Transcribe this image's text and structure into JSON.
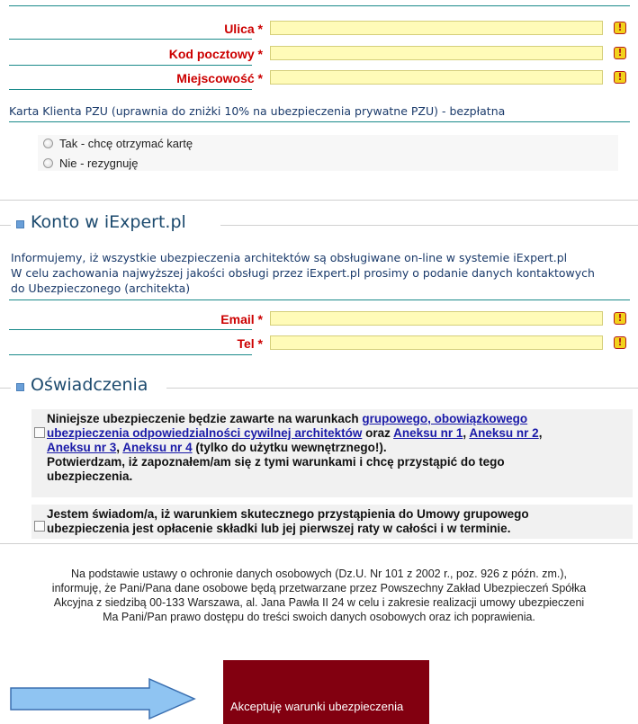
{
  "address": {
    "fields": [
      {
        "label": "Ulica",
        "required": "*",
        "warning": "!"
      },
      {
        "label": "Kod pocztowy",
        "required": "*",
        "warning": "!"
      },
      {
        "label": "Miejscowość",
        "required": "*",
        "warning": "!"
      }
    ]
  },
  "card": {
    "title": "Karta Klienta PZU (uprawnia do zniżki 10% na ubezpieczenia prywatne PZU) - bezpłatna",
    "options": [
      "Tak - chcę otrzymać kartę",
      "Nie - rezygnuję"
    ]
  },
  "account": {
    "title": "Konto w iExpert.pl",
    "info_lines": [
      "Informujemy, iż wszystkie ubezpieczenia architektów są obsługiwane on-line w systemie iExpert.pl",
      "W celu zachowania najwyższej jakości obsługi przez iExpert.pl prosimy o podanie danych kontaktowych",
      "do Ubezpieczonego (architekta)"
    ],
    "fields": [
      {
        "label": "Email",
        "required": "*",
        "warning": "!"
      },
      {
        "label": "Tel",
        "required": "*",
        "warning": "!"
      }
    ]
  },
  "declarations": {
    "title": "Oświadczenia",
    "first": {
      "t1": "Niniejsze ubezpieczenie będzie zawarte na warunkach ",
      "link1a": "grupowego, obowiązkowego",
      "link1b": "ubezpieczenia odpowiedzialności cywilnej architektów",
      "t2": " oraz ",
      "link2": "Aneksu nr 1",
      "t3": ", ",
      "link3": "Aneksu nr 2",
      "t4": ",",
      "link4": "Aneksu nr 3",
      "t5": ", ",
      "link5": "Aneksu nr 4",
      "t6": " (tylko do użytku wewnętrznego!).",
      "line4": "Potwierdzam, iż zapoznałem/am się z tymi warunkami i chcę przystąpić do tego",
      "line5": "ubezpieczenia."
    },
    "second": {
      "line1": "Jestem świadom/a, iż warunkiem skutecznego przystąpienia do Umowy grupowego",
      "line2": "ubezpieczenia jest opłacenie składki lub jej pierwszej raty w całości i w terminie."
    }
  },
  "legal": {
    "lines": [
      "Na podstawie ustawy o ochronie danych osobowych (Dz.U. Nr 101 z 2002 r., poz. 926 z późn. zm.),",
      "informuję, że Pani/Pana dane osobowe będą przetwarzane przez Powszechny Zakład Ubezpieczeń Spółka",
      "Akcyjna z siedzibą 00-133 Warszawa, al. Jana Pawła II 24 w celu i zakresie realizacji umowy ubezpieczeni",
      "Ma Pani/Pan prawo dostępu do treści swoich danych osobowych oraz ich poprawienia."
    ]
  },
  "accept_button": "Akceptuję warunki ubezpieczenia",
  "colors": {
    "accent_red": "#cc0000",
    "button": "#820010",
    "field": "#fffbb8",
    "arrow": "#8fc4f2"
  }
}
